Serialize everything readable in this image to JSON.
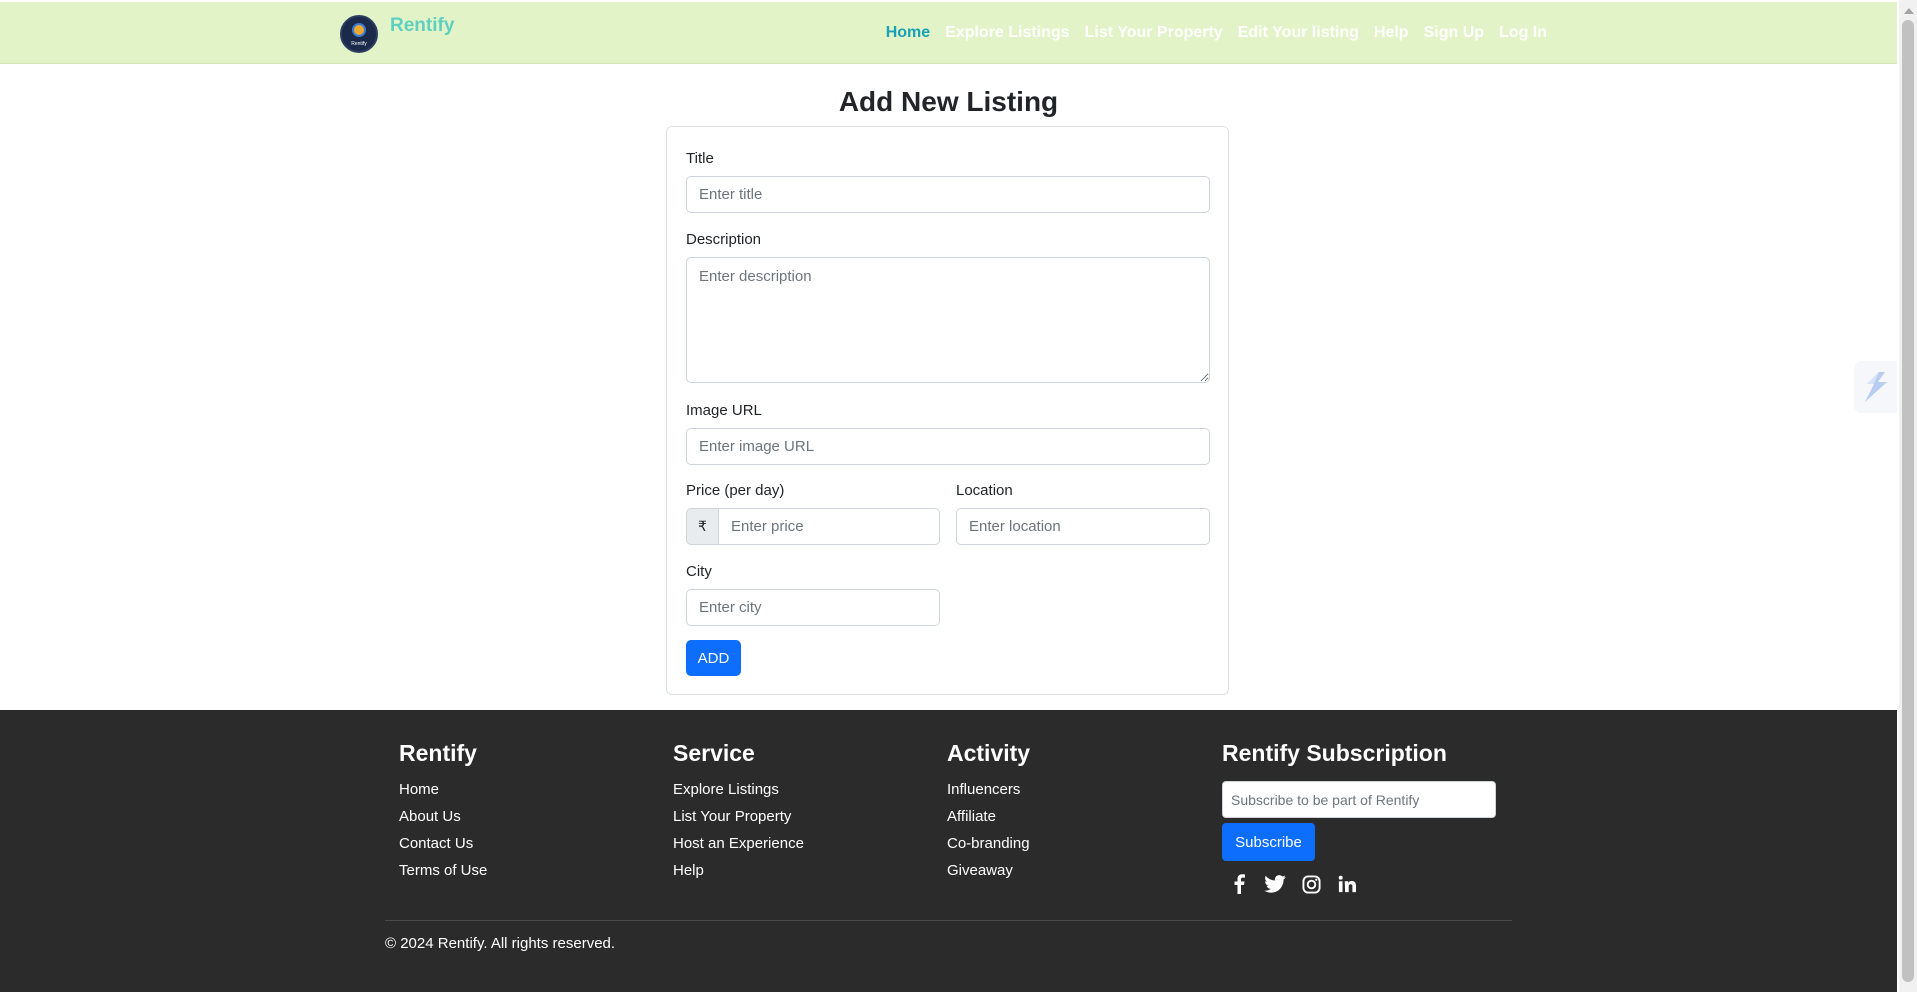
{
  "nav": {
    "brand": "Rentify",
    "logo_text": "Rentify",
    "links": [
      {
        "label": "Home",
        "active": true
      },
      {
        "label": "Explore Listings"
      },
      {
        "label": "List Your Property"
      },
      {
        "label": "Edit Your listing"
      },
      {
        "label": "Help"
      },
      {
        "label": "Sign Up"
      },
      {
        "label": "Log In"
      }
    ]
  },
  "page_title": "Add New Listing",
  "form": {
    "title": {
      "label": "Title",
      "placeholder": "Enter title"
    },
    "description": {
      "label": "Description",
      "placeholder": "Enter description"
    },
    "image_url": {
      "label": "Image URL",
      "placeholder": "Enter image URL"
    },
    "price": {
      "label": "Price (per day)",
      "currency": "₹",
      "placeholder": "Enter price"
    },
    "location": {
      "label": "Location",
      "placeholder": "Enter location"
    },
    "city": {
      "label": "City",
      "placeholder": "Enter city"
    },
    "submit_label": "ADD"
  },
  "footer": {
    "columns": [
      {
        "heading": "Rentify",
        "links": [
          "Home",
          "About Us",
          "Contact Us",
          "Terms of Use"
        ]
      },
      {
        "heading": "Service",
        "links": [
          "Explore Listings",
          "List Your Property",
          "Host an Experience",
          "Help"
        ]
      },
      {
        "heading": "Activity",
        "links": [
          "Influencers",
          "Affiliate",
          "Co-branding",
          "Giveaway"
        ]
      }
    ],
    "subscription": {
      "heading": "Rentify Subscription",
      "placeholder": "Subscribe to be part of Rentify",
      "button_label": "Subscribe",
      "socials": [
        "facebook-icon",
        "twitter-icon",
        "instagram-icon",
        "linkedin-icon"
      ]
    },
    "copyright": "© 2024 Rentify. All rights reserved."
  },
  "colors": {
    "nav_bg": "#e2f4c7",
    "brand": "#5fd0c0",
    "nav_active": "#17a2b8",
    "primary_button": "#0d6efd",
    "footer_bg": "#2b2b2b"
  }
}
